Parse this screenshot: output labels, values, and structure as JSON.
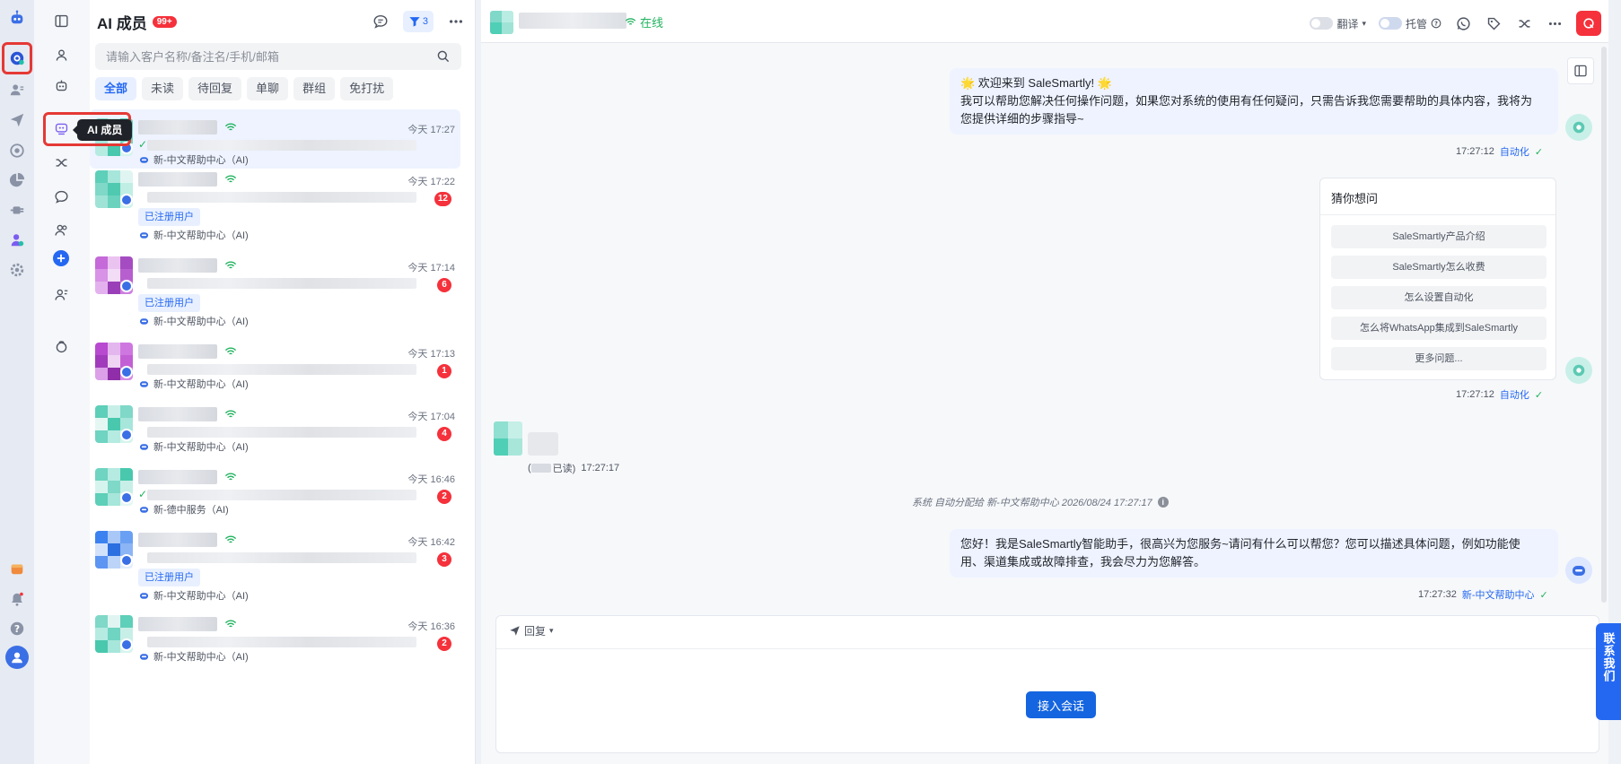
{
  "colors": {
    "accent": "#2468f2",
    "danger": "#f5313b",
    "online": "#21b35f"
  },
  "list": {
    "title": "AI 成员",
    "badge": "99+",
    "filter_count": "3",
    "search_placeholder": "请输入客户名称/备注名/手机/邮箱",
    "tabs": [
      "全部",
      "未读",
      "待回复",
      "单聊",
      "群组",
      "免打扰"
    ],
    "rows": [
      {
        "time": "今天 17:27",
        "unread": "",
        "tag": "",
        "agent": "新-中文帮助中心（AI)",
        "read_check": "✓"
      },
      {
        "time": "今天 17:22",
        "unread": "12",
        "tag": "已注册用户",
        "agent": "新-中文帮助中心（AI)",
        "read_check": ""
      },
      {
        "time": "今天 17:14",
        "unread": "6",
        "tag": "已注册用户",
        "agent": "新-中文帮助中心（AI)",
        "read_check": ""
      },
      {
        "time": "今天 17:13",
        "unread": "1",
        "tag": "",
        "agent": "新-中文帮助中心（AI)",
        "read_check": ""
      },
      {
        "time": "今天 17:04",
        "unread": "4",
        "tag": "",
        "agent": "新-中文帮助中心（AI)",
        "read_check": ""
      },
      {
        "time": "今天 16:46",
        "unread": "2",
        "tag": "",
        "agent": "新-德中服务（AI)",
        "read_check": "✓"
      },
      {
        "time": "今天 16:42",
        "unread": "3",
        "tag": "已注册用户",
        "agent": "新-中文帮助中心（AI)",
        "read_check": ""
      },
      {
        "time": "今天 16:36",
        "unread": "2",
        "tag": "",
        "agent": "新-中文帮助中心（AI)",
        "read_check": ""
      }
    ]
  },
  "tooltip": "AI 成员",
  "chat": {
    "status": "在线",
    "translate_label": "翻译",
    "custody_label": "托管",
    "welcome_line1": "🌟 欢迎来到 SaleSmartly! 🌟",
    "welcome_line2": "我可以帮助您解决任何操作问题，如果您对系统的使用有任何疑问，只需告诉我您需要帮助的具体内容，我将为",
    "welcome_line3": "您提供详细的步骤指导~",
    "msg1_time": "17:27:12",
    "msg1_source": "自动化",
    "guess_title": "猜你想问",
    "guess_items": [
      "SaleSmartly产品介绍",
      "SaleSmartly怎么收费",
      "怎么设置自动化",
      "怎么将WhatsApp集成到SaleSmartly",
      "更多问题..."
    ],
    "msg2_time": "17:27:12",
    "msg2_source": "自动化",
    "customer_read": "已读)",
    "customer_time": "17:27:17",
    "system_note": "系统 自动分配给 新-中文帮助中心 2026/08/24 17:27:17",
    "reply_line1": "您好！我是SaleSmartly智能助手，很高兴为您服务~请问有什么可以帮您？您可以描述具体问题，例如功能使",
    "reply_line2": "用、渠道集成或故障排查，我会尽力为您解答。",
    "msg3_time": "17:27:32",
    "msg3_source": "新-中文帮助中心",
    "reply_label": "回复",
    "join_button": "接入会话",
    "contact_us": "联系我们"
  }
}
